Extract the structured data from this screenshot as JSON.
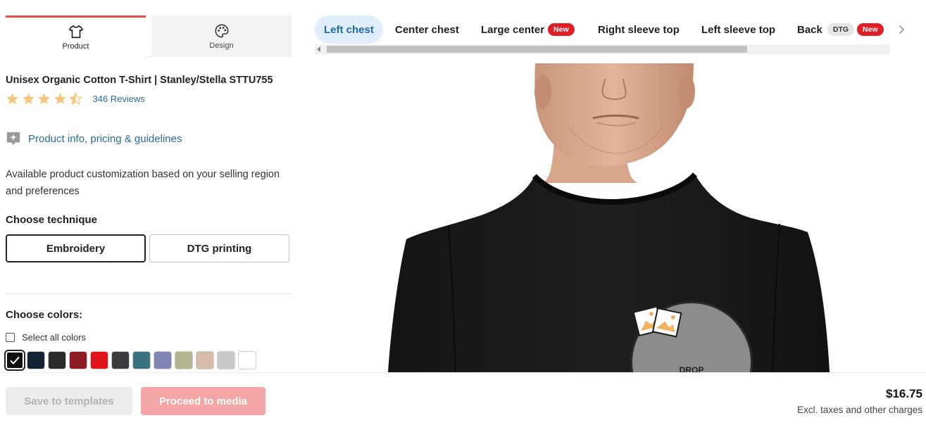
{
  "tabs": [
    {
      "label": "Product",
      "icon": "tshirt-icon",
      "active": true
    },
    {
      "label": "Design",
      "icon": "palette-icon",
      "active": false
    }
  ],
  "product": {
    "title": "Unisex Organic Cotton T-Shirt | Stanley/Stella STTU755",
    "rating": 4.5,
    "reviews_label": "346 Reviews",
    "info_link": "Product info, pricing & guidelines",
    "description": "Available product customization based on your selling region and preferences"
  },
  "technique": {
    "label": "Choose technique",
    "options": [
      {
        "label": "Embroidery",
        "selected": true
      },
      {
        "label": "DTG printing",
        "selected": false
      }
    ]
  },
  "colors": {
    "label": "Choose colors:",
    "select_all": "Select all colors",
    "swatches": [
      "#111111",
      "#142236",
      "#2b2b2b",
      "#8c1d22",
      "#e3131b",
      "#3b3a3d",
      "#3b7280",
      "#7f86b5",
      "#b4b48e",
      "#d6bba7",
      "#c9c8c8",
      "#ffffff"
    ],
    "selected_index": 0
  },
  "placements": [
    {
      "label": "Left chest",
      "active": true
    },
    {
      "label": "Center chest"
    },
    {
      "label": "Large center",
      "badges": [
        "New"
      ]
    },
    {
      "label": "Right sleeve top"
    },
    {
      "label": "Left sleeve top"
    },
    {
      "label": "Back",
      "badges": [
        "DTG",
        "New"
      ]
    }
  ],
  "mockup": {
    "drop_text": "DROP"
  },
  "footer": {
    "save_label": "Save to templates",
    "proceed_label": "Proceed to media",
    "price": "$16.75",
    "price_note": "Excl. taxes and other charges"
  },
  "theme": {
    "accent": "#e94b4b",
    "link": "#2c6c9c",
    "active_tab_bg": "#dfeefa",
    "badge_red": "#e01e26",
    "star": "#f5c57a"
  }
}
